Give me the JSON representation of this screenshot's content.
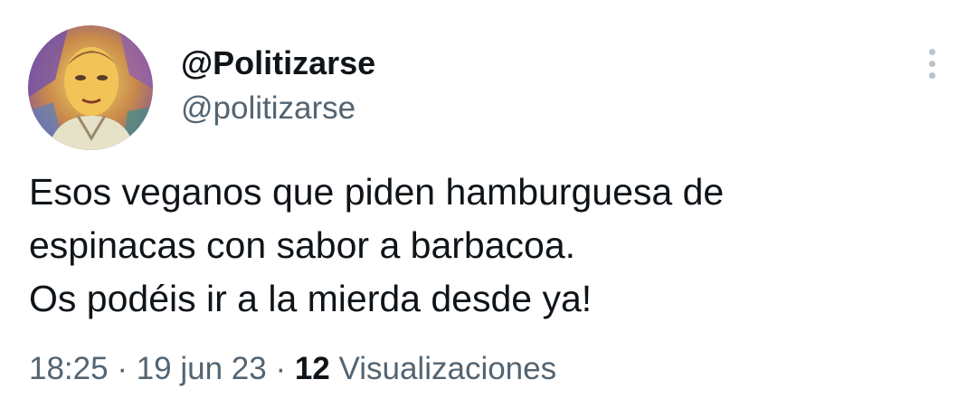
{
  "author": {
    "display_name": "@Politizarse",
    "handle": "@politizarse",
    "avatar_icon": "profile-avatar-photo"
  },
  "more_icon": "more-options-vertical-dots-icon",
  "tweet": {
    "lines": [
      "Esos veganos que piden hamburguesa de",
      "espinacas con sabor a barbacoa.",
      "Os podéis ir a la mierda desde ya!"
    ]
  },
  "meta": {
    "time": "18:25",
    "separator": " · ",
    "date": "19 jun 23",
    "views_count": "12",
    "views_label": " Visualizaciones"
  },
  "colors": {
    "text": "#0f1419",
    "secondary": "#536471",
    "icon_gray": "#b9c3cc"
  }
}
